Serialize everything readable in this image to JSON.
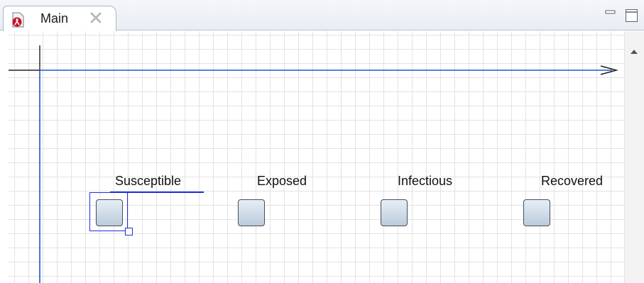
{
  "tab": {
    "label": "Main",
    "icon": "agent-model-icon",
    "close_icon": "close-tab-icon"
  },
  "window_controls": {
    "minimize_icon": "minimize-icon",
    "maximize_icon": "maximize-icon"
  },
  "diagram": {
    "nodes": [
      {
        "label": "Susceptible",
        "selected": true
      },
      {
        "label": "Exposed",
        "selected": false
      },
      {
        "label": "Infectious",
        "selected": false
      },
      {
        "label": "Recovered",
        "selected": false
      }
    ]
  },
  "colors": {
    "selection": "#1d2fe0",
    "axis_blue": "#1e56c8",
    "grid": "#e3e3e3",
    "stock_fill_top": "#e6eef7",
    "stock_fill_bottom": "#bccbdc"
  }
}
